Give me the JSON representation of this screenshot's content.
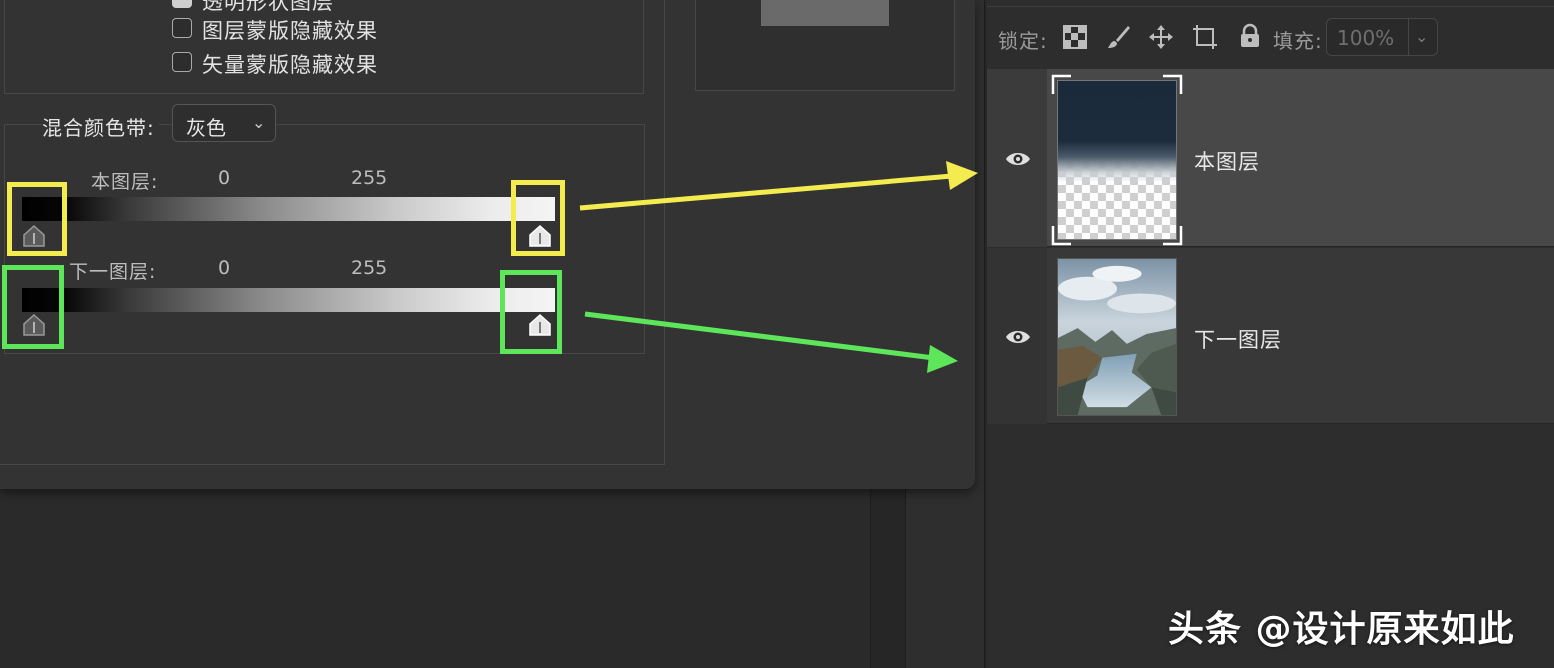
{
  "dialog": {
    "checkboxes": [
      {
        "label": "透明形状图层",
        "checked": true
      },
      {
        "label": "图层蒙版隐藏效果",
        "checked": false
      },
      {
        "label": "矢量蒙版隐藏效果",
        "checked": false
      }
    ],
    "blend_if": {
      "label": "混合颜色带:",
      "selected": "灰色"
    },
    "this_layer": {
      "label": "本图层:",
      "min": "0",
      "max": "255"
    },
    "underlying_layer": {
      "label": "下一图层:",
      "min": "0",
      "max": "255"
    }
  },
  "layers_panel": {
    "lock_label": "锁定:",
    "fill_label": "填充:",
    "fill_value": "100%",
    "lock_icons": [
      "lock-transparent-pixels-icon",
      "lock-image-pixels-icon",
      "lock-position-icon",
      "lock-artboard-icon",
      "lock-all-icon"
    ],
    "layers": [
      {
        "name": "本图层",
        "visible": true,
        "selected": true
      },
      {
        "name": "下一图层",
        "visible": true,
        "selected": false
      }
    ]
  },
  "annotations": {
    "this_layer_highlight_color": "#f4ec4e",
    "underlying_highlight_color": "#5ee65a"
  },
  "watermark": "头条 @设计原来如此"
}
